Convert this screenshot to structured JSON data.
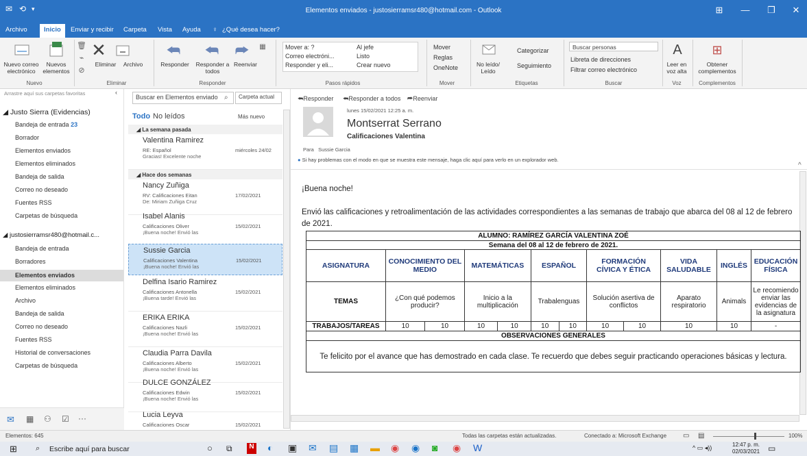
{
  "window": {
    "title": "Elementos enviados - justosierramsr480@hotmail.com - Outlook"
  },
  "menu": [
    "Archivo",
    "Inicio",
    "Enviar y recibir",
    "Carpeta",
    "Vista",
    "Ayuda"
  ],
  "search_tell": "¿Qué desea hacer?",
  "ribbon": {
    "nuevo_correo": "Nuevo correo electrónico",
    "nuevos_elementos": "Nuevos elementos",
    "eliminar": "Eliminar",
    "archivo": "Archivo",
    "responder": "Responder",
    "responder_todos": "Responder a todos",
    "reenviar": "Reenviar",
    "mover_a": "Mover a: ?",
    "correo_electronico": "Correo electróni...",
    "responder_y_el": "Responder y eli...",
    "al_jefe": "Al jefe",
    "listo": "Listo",
    "crear_nuevo": "Crear nuevo",
    "mover": "Mover",
    "reglas": "Reglas",
    "onenote": "OneNote",
    "no_leido": "No leído/ Leído",
    "categorizar": "Categorizar",
    "seguimiento": "Seguimiento",
    "buscar_personas": "Buscar personas",
    "libreta": "Libreta de direcciones",
    "filtrar": "Filtrar correo electrónico",
    "leer_voz": "Leer en voz alta",
    "obtener": "Obtener complementos",
    "groups": [
      "Nuevo",
      "Eliminar",
      "Responder",
      "Pasos rápidos",
      "Mover",
      "Etiquetas",
      "Buscar",
      "Voz",
      "Complementos"
    ]
  },
  "nav": {
    "drag_hint": "Arrastre aquí sus carpetas favoritas",
    "account1": "Justo Sierra (Evidencias)",
    "folders1": [
      {
        "label": "Bandeja de entrada",
        "count": "23"
      },
      {
        "label": "Borrador"
      },
      {
        "label": "Elementos enviados"
      },
      {
        "label": "Elementos eliminados"
      },
      {
        "label": "Bandeja de salida"
      },
      {
        "label": "Correo no deseado"
      },
      {
        "label": "Fuentes RSS"
      },
      {
        "label": "Carpetas de búsqueda"
      }
    ],
    "account2": "justosierramsr480@hotmail.c...",
    "folders2": [
      "Bandeja de entrada",
      "Borradores",
      "Elementos enviados",
      "Elementos eliminados",
      "Archivo",
      "Bandeja de salida",
      "Correo no deseado",
      "Fuentes RSS",
      "Historial de conversaciones",
      "Carpetas de búsqueda"
    ]
  },
  "list": {
    "search_placeholder": "Buscar en Elementos enviado",
    "scope": "Carpeta actual",
    "tab_all": "Todo",
    "tab_unread": "No leídos",
    "sort": "Más nuevo",
    "group1": "La semana pasada",
    "group2": "Hace dos semanas",
    "messages": [
      {
        "from": "Valentina Ramirez",
        "subject": "RE: Español",
        "date": "miércoles 24/02",
        "preview": "Gracias!  Excelente noche"
      },
      {
        "from": "Nancy Zuñiga",
        "subject": "RV: Calificaciones Eitan",
        "date": "17/02/2021",
        "preview": "De: Miriam Zuñiga Cruz"
      },
      {
        "from": "Isabel Alanis",
        "subject": "Calificaciones Oliver",
        "date": "15/02/2021",
        "preview": "¡Buena noche!  Envió las"
      },
      {
        "from": "Sussie Garcia",
        "subject": "Calificaciones Valentina",
        "date": "15/02/2021",
        "preview": "¡Buena noche!  Envió las"
      },
      {
        "from": "Delfina Isario Ramirez",
        "subject": "Calificaciones Antonella",
        "date": "15/02/2021",
        "preview": "¡Buena tarde!  Envió las"
      },
      {
        "from": "ERIKA ERIKA",
        "subject": "Calificaciones Nazli",
        "date": "15/02/2021",
        "preview": "¡Buena noche!  Envió las"
      },
      {
        "from": "Claudia Parra Davila",
        "subject": "Calificaciones Alberto",
        "date": "15/02/2021",
        "preview": "¡Buena noche!  Envió las"
      },
      {
        "from": "DULCE GONZÁLEZ",
        "subject": "Calificaciones Edwin",
        "date": "15/02/2021",
        "preview": "¡Buena noche!  Envió las"
      },
      {
        "from": "Lucia Leyva",
        "subject": "Calificaciones Oscar",
        "date": "15/02/2021",
        "preview": ""
      }
    ]
  },
  "reading": {
    "actions": [
      "Responder",
      "Responder a todos",
      "Reenviar"
    ],
    "datetime": "lunes 15/02/2021 12:25 a. m.",
    "sender": "Montserrat Serrano",
    "subject": "Calificaciones Valentina",
    "to_label": "Para",
    "to": "Sussie Garcia",
    "info": "Si hay problemas con el modo en que se muestra este mensaje, haga clic aquí para verlo en un explorador web.",
    "greeting": "¡Buena noche!",
    "paragraph": "Envió las calificaciones y retroalimentación de las actividades correspondientes a las semanas de trabajo que abarca del 08 al 12 de febrero de 2021.",
    "table": {
      "student": "ALUMNO: RAMÍREZ GARCÍA VALENTINA ZOÉ",
      "week": "Semana del 08 al 12 de febrero de 2021.",
      "headers": [
        "ASIGNATURA",
        "CONOCIMIENTO DEL MEDIO",
        "MATEMÁTICAS",
        "ESPAÑOL",
        "FORMACIÓN CÍVICA Y ÉTICA",
        "VIDA SALUDABLE",
        "INGLÉS",
        "EDUCACIÓN FÍSICA"
      ],
      "temas_label": "TEMAS",
      "temas": [
        "¿Con qué podemos producir?",
        "Inicio a la multiplicación",
        "Trabalenguas",
        "Solución asertiva de conflictos",
        "Aparato respiratorio",
        "Animals",
        "Le recomiendo enviar las evidencias de la asignatura"
      ],
      "trabajos_label": "TRABAJOS/TAREAS",
      "scores": [
        "10",
        "10",
        "10",
        "10",
        "10",
        "10",
        "10",
        "10",
        "10",
        "10",
        "-"
      ],
      "obs_label": "OBSERVACIONES GENERALES",
      "obs": "Te felicito por el avance que has demostrado en cada clase. Te recuerdo que debes seguir practicando operaciones básicas y lectura."
    }
  },
  "status": {
    "items": "Elementos: 645",
    "updated": "Todas las carpetas están actualizadas.",
    "connected": "Conectado a: Microsoft Exchange",
    "zoom": "100%"
  },
  "taskbar": {
    "search": "Escribe aquí para buscar",
    "time": "12:47 p. m.",
    "date": "02/03/2021"
  },
  "colors": {
    "accent": "#2b73c4",
    "selected": "#cde3f7",
    "header_text": "#1f3a7a"
  }
}
